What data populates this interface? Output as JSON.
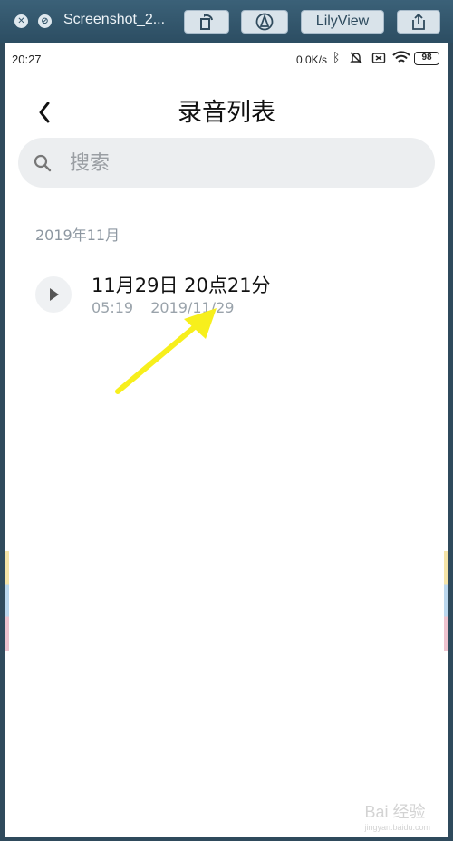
{
  "viewer": {
    "title": "Screenshot_2...",
    "lilyview_label": "LilyView",
    "icons": [
      "close-icon",
      "minimize-icon",
      "rotate-icon",
      "markup-icon",
      "share-icon"
    ]
  },
  "status_bar": {
    "time": "20:27",
    "net_speed": "0.0K/s",
    "battery": "98",
    "icons": [
      "bluetooth-icon",
      "mute-icon",
      "sim-icon",
      "wifi-icon",
      "battery-icon"
    ]
  },
  "header": {
    "title": "录音列表",
    "back_icon": "chevron-left-icon"
  },
  "search": {
    "placeholder": "搜索",
    "icon": "search-icon"
  },
  "sections": [
    {
      "label": "2019年11月",
      "items": [
        {
          "title": "11月29日 20点21分",
          "duration": "05:19",
          "date": "2019/11/29"
        }
      ]
    }
  ],
  "annotation": {
    "arrow_color": "#f7ef1c"
  },
  "watermark": {
    "text": "Bai 经验",
    "sub": "jingyan.baidu.com"
  }
}
